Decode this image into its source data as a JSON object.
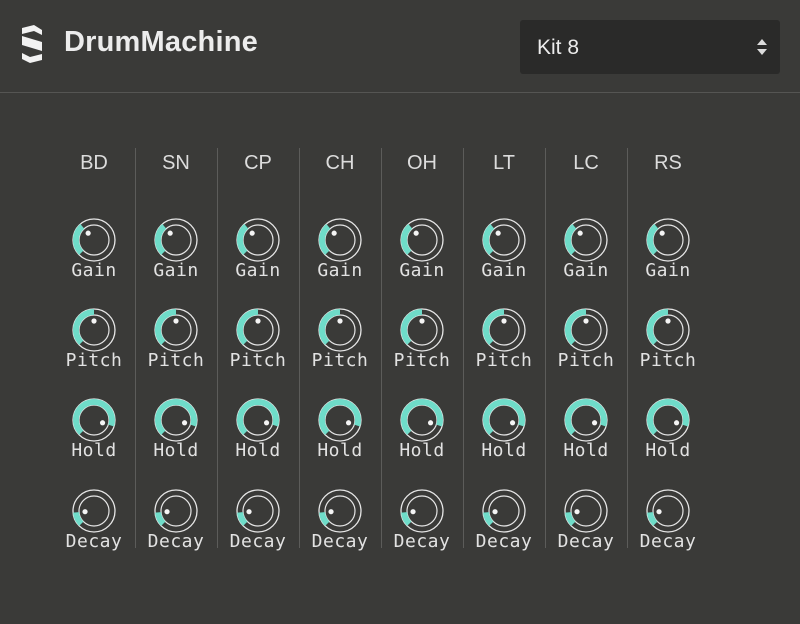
{
  "app": {
    "title": "DrumMachine",
    "logo": "layered-s-logo"
  },
  "kit_select": {
    "value": "Kit 8",
    "icon": "updown-arrows-icon"
  },
  "colors": {
    "accent": "#6fdcc9",
    "background": "#3a3a38",
    "select_bg": "#2a2a29",
    "outline": "#e6e6e6"
  },
  "knob_labels": [
    "Gain",
    "Pitch",
    "Hold",
    "Decay"
  ],
  "channels": [
    {
      "name": "BD",
      "knobs": {
        "gain": 0.35,
        "pitch": 0.5,
        "hold": 0.9,
        "decay": 0.15
      }
    },
    {
      "name": "SN",
      "knobs": {
        "gain": 0.35,
        "pitch": 0.5,
        "hold": 0.9,
        "decay": 0.15
      }
    },
    {
      "name": "CP",
      "knobs": {
        "gain": 0.35,
        "pitch": 0.5,
        "hold": 0.9,
        "decay": 0.15
      }
    },
    {
      "name": "CH",
      "knobs": {
        "gain": 0.35,
        "pitch": 0.5,
        "hold": 0.9,
        "decay": 0.15
      }
    },
    {
      "name": "OH",
      "knobs": {
        "gain": 0.35,
        "pitch": 0.5,
        "hold": 0.9,
        "decay": 0.15
      }
    },
    {
      "name": "LT",
      "knobs": {
        "gain": 0.35,
        "pitch": 0.5,
        "hold": 0.9,
        "decay": 0.15
      }
    },
    {
      "name": "LC",
      "knobs": {
        "gain": 0.35,
        "pitch": 0.5,
        "hold": 0.9,
        "decay": 0.15
      }
    },
    {
      "name": "RS",
      "knobs": {
        "gain": 0.35,
        "pitch": 0.5,
        "hold": 0.9,
        "decay": 0.15
      }
    }
  ]
}
